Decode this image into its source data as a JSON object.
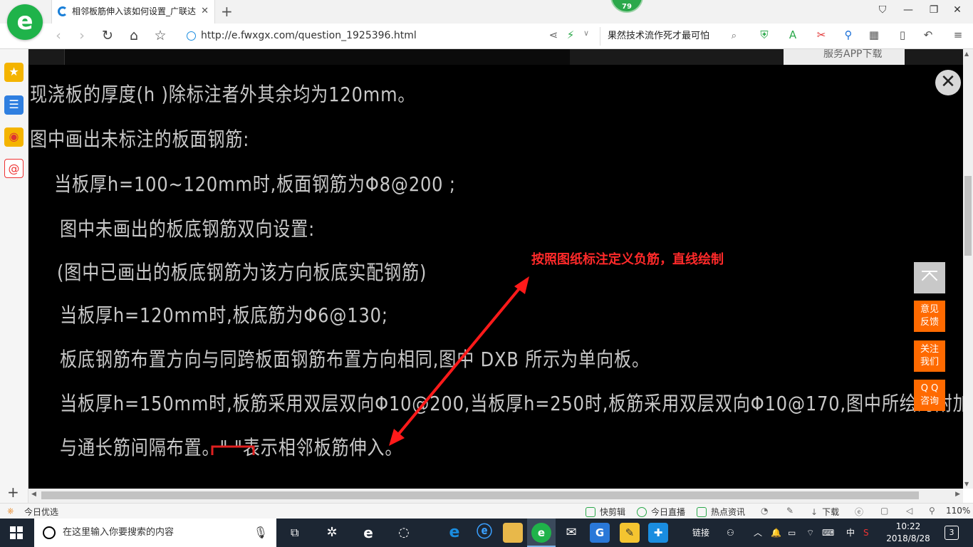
{
  "browser": {
    "tab": {
      "title": "相邻板筋伸入该如何设置_广联达",
      "close": "✕"
    },
    "new_tab": "+",
    "badge": "79",
    "window_controls": {
      "pin": "⛉",
      "minimize": "—",
      "restore": "❐",
      "close": "✕"
    },
    "address_url": "http://e.fwxgx.com/question_1925396.html",
    "search_text": "果然技术流作死才最可怕",
    "nav": {
      "back": "‹",
      "forward": "›",
      "refresh": "↻",
      "home": "⌂",
      "star": "☆"
    }
  },
  "page": {
    "cad_lines": [
      "现浇板的厚度(h )除标注者外其余均为120mm。",
      "图中画出未标注的板面钢筋:",
      "当板厚h=100~120mm时,板面钢筋为Φ8@200 ;",
      "图中未画出的板底钢筋双向设置:",
      "(图中已画出的板底钢筋为该方向板底实配钢筋)",
      "当板厚h=120mm时,板底筋为Φ6@130;",
      "板底钢筋布置方向与同跨板面钢筋布置方向相同,图中 DXB 所示为单向板。",
      "当板厚h=150mm时,板筋采用双层双向Φ10@200,当板厚h=250时,板筋采用双层双向Φ10@170,图中所绘为附加筋,",
      "与通长筋间隔布置。\"     \"表示相邻板筋伸入。"
    ],
    "annotation": "按照图纸标注定义负筋，直线绘制",
    "app_strip_text": "服务APP下载",
    "close_label": "✕",
    "float_buttons": [
      {
        "line1": "意见",
        "line2": "反馈"
      },
      {
        "line1": "关注",
        "line2": "我们"
      },
      {
        "line1": "Q Q",
        "line2": "咨询"
      }
    ]
  },
  "sidebar": {
    "add": "+"
  },
  "statusbar": {
    "left": "今日优选",
    "items": [
      "快剪辑",
      "今日直播",
      "热点资讯",
      "下载"
    ],
    "zoom": "110%"
  },
  "taskbar": {
    "search_placeholder": "在这里输入你要搜索的内容",
    "tray_links": "链接",
    "ime": "中",
    "time": "10:22",
    "date": "2018/8/28",
    "notifications": "3"
  },
  "colors": {
    "accent": "#1fb34a",
    "annotation": "#ff2a2a",
    "float": "#ff6a00",
    "taskbar": "#1c2633"
  }
}
